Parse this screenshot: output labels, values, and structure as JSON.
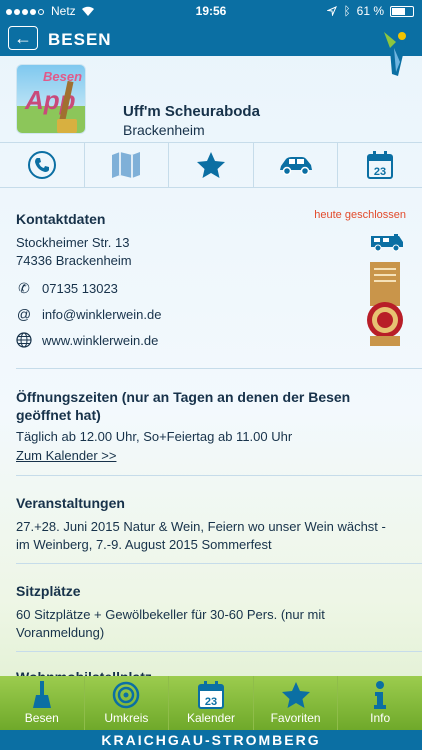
{
  "status": {
    "carrier": "Netz",
    "time": "19:56",
    "battery": "61 %"
  },
  "nav": {
    "back_icon": "←",
    "title": "BESEN"
  },
  "venue": {
    "icon_top": "Besen",
    "icon_main": "App",
    "name": "Uff'm Scheuraboda",
    "town": "Brackenheim"
  },
  "iconrow": [
    {
      "name": "phone-icon"
    },
    {
      "name": "map-icon"
    },
    {
      "name": "star-icon"
    },
    {
      "name": "car-icon"
    },
    {
      "name": "calendar-icon",
      "day": "23"
    }
  ],
  "contact": {
    "title": "Kontaktdaten",
    "closed_label": "heute geschlossen",
    "street": "Stockheimer Str. 13",
    "city": "74336 Brackenheim",
    "phone": "07135 13023",
    "email": "info@winklerwein.de",
    "website": "www.winklerwein.de",
    "email_symbol": "@",
    "phone_symbol": "✆"
  },
  "hours": {
    "title_line1": "Öffnungszeiten (nur an Tagen an denen der Besen",
    "title_line2": "geöffnet hat)",
    "text": "Täglich ab 12.00 Uhr, So+Feiertag ab 11.00 Uhr",
    "calendar_link": "Zum Kalender >>"
  },
  "events": {
    "title": "Veranstaltungen",
    "line1": "27.+28. Juni 2015 Natur & Wein, Feiern wo unser Wein wächst -",
    "line2": "im Weinberg, 7.-9. August 2015 Sommerfest"
  },
  "seats": {
    "title": "Sitzplätze",
    "line1": "60 Sitzplätze + Gewölbekeller für 30-60 Pers. (nur mit",
    "line2": "Voranmeldung)"
  },
  "next_section_partial": "Wohnmobilstellplatz",
  "tabs": [
    {
      "label": "Besen"
    },
    {
      "label": "Umkreis"
    },
    {
      "label": "Kalender",
      "day": "23"
    },
    {
      "label": "Favoriten"
    },
    {
      "label": "Info"
    }
  ],
  "footer": "KRAICHGAU-STROMBERG",
  "colors": {
    "brand_blue": "#0b6fa3",
    "tab_green": "#7fb734",
    "closed_red": "#e24b2c"
  }
}
